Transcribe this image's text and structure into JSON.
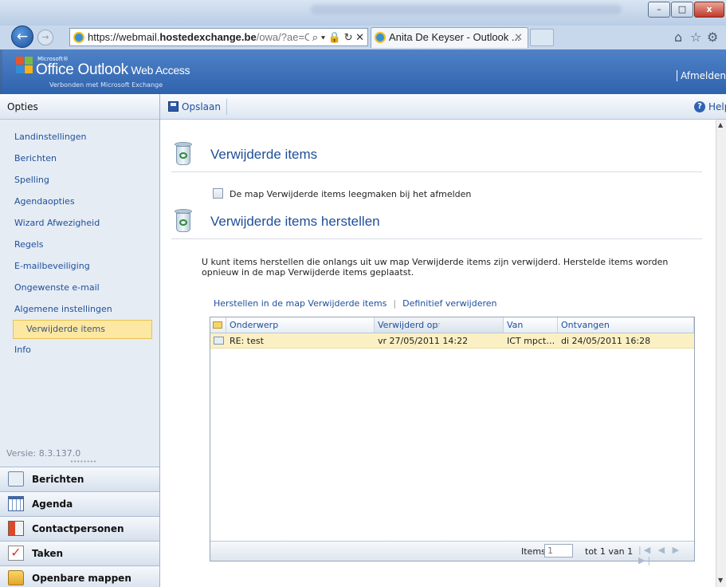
{
  "browser": {
    "url_host": "https://webmail.",
    "url_bold": "hostedexchange.be",
    "url_path": "/owa/?ae=O",
    "url_controls": "⌕ ▾ 🔒 ↻ ✕",
    "tab_title": "Anita De Keyser - Outlook ...",
    "tab_close": "✕",
    "min": "–",
    "max": "□",
    "close": "x"
  },
  "owa": {
    "microsoft": "Microsoft®",
    "title_main": "Office Outlook",
    "title_web": " Web Access",
    "subtitle": "Verbonden met Microsoft Exchange",
    "signout": "Afmelden"
  },
  "sidebar": {
    "header": "Opties",
    "items": [
      {
        "label": "Landinstellingen"
      },
      {
        "label": "Berichten"
      },
      {
        "label": "Spelling"
      },
      {
        "label": "Agendaopties"
      },
      {
        "label": "Wizard Afwezigheid"
      },
      {
        "label": "Regels"
      },
      {
        "label": "E-mailbeveiliging"
      },
      {
        "label": "Ongewenste e-mail"
      },
      {
        "label": "Algemene instellingen"
      },
      {
        "label": "Verwijderde items"
      },
      {
        "label": "Info"
      }
    ],
    "version": "Versie: 8.3.137.0",
    "grip": "••••••••",
    "modules": [
      {
        "label": "Berichten",
        "icon": "mail-icon"
      },
      {
        "label": "Agenda",
        "icon": "calendar-icon"
      },
      {
        "label": "Contactpersonen",
        "icon": "contacts-icon"
      },
      {
        "label": "Taken",
        "icon": "tasks-icon"
      },
      {
        "label": "Openbare mappen",
        "icon": "folder-icon"
      }
    ]
  },
  "toolbar": {
    "save": "Opslaan",
    "help": "Help",
    "help_glyph": "?"
  },
  "main": {
    "section1_title": "Verwijderde items",
    "checkbox_label": "De map Verwijderde items leegmaken bij het afmelden",
    "section2_title": "Verwijderde items herstellen",
    "info": "U kunt items herstellen die onlangs uit uw map Verwijderde items zijn verwijderd. Herstelde items worden opnieuw in de map Verwijderde items geplaatst.",
    "action_restore": "Herstellen in de map Verwijderde items",
    "action_sep": "|",
    "action_purge": "Definitief verwijderen"
  },
  "grid": {
    "columns": [
      "Onderwerp",
      "Verwijderd op",
      "Van",
      "Ontvangen"
    ],
    "sort_arrow": "▽",
    "rows": [
      {
        "subject": "RE: test",
        "deleted": "vr 27/05/2011 14:22",
        "from": "ICT mpcter…",
        "received": "di 24/05/2011 16:28"
      }
    ],
    "footer_items_label": "Items",
    "footer_items_value": "1",
    "footer_range": "tot 1 van 1",
    "pager": "|◀ ◀ ▶ ▶|"
  },
  "colors": {
    "accent": "#1e4f9c",
    "selection": "#fde8a3",
    "header": "#3a6db8"
  }
}
